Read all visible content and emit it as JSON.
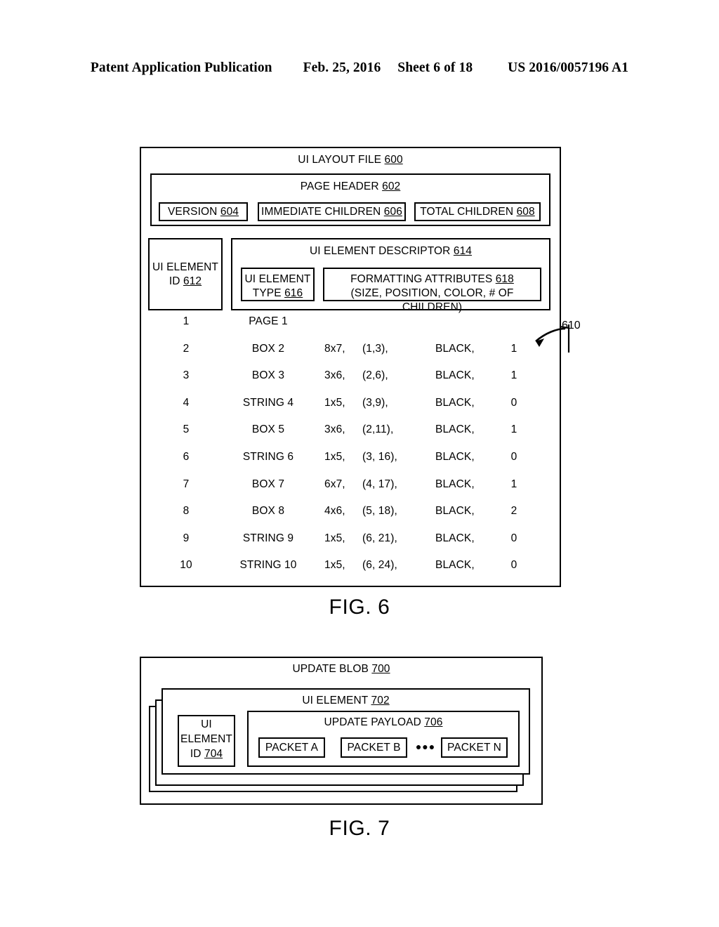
{
  "header": {
    "publication": "Patent Application Publication",
    "date": "Feb. 25, 2016",
    "sheet": "Sheet 6 of 18",
    "patent_number": "US 2016/0057196 A1"
  },
  "fig6": {
    "caption": "FIG. 6",
    "title": "UI LAYOUT FILE",
    "title_ref": "600",
    "page_header": {
      "title": "PAGE HEADER",
      "ref": "602",
      "fields": [
        {
          "label": "VERSION",
          "ref": "604"
        },
        {
          "label": "IMMEDIATE CHILDREN",
          "ref": "606"
        },
        {
          "label": "TOTAL CHILDREN",
          "ref": "608"
        }
      ]
    },
    "element_id_box": {
      "line1": "UI ELEMENT",
      "line2": "ID",
      "ref": "612"
    },
    "descriptor": {
      "title": "UI ELEMENT DESCRIPTOR",
      "ref": "614",
      "type_box": {
        "line1": "UI ELEMENT",
        "line2": "TYPE",
        "ref": "616"
      },
      "attributes_box": {
        "line1": "FORMATTING ATTRIBUTES",
        "ref": "618",
        "line2": "(SIZE, POSITION, COLOR, # OF CHILDREN)"
      }
    },
    "table_ref": "610",
    "rows": [
      {
        "id": "1",
        "type": "PAGE 1",
        "size": "",
        "position": "",
        "color": "",
        "children": ""
      },
      {
        "id": "2",
        "type": "BOX 2",
        "size": "8x7,",
        "position": "(1,3),",
        "color": "BLACK,",
        "children": "1"
      },
      {
        "id": "3",
        "type": "BOX 3",
        "size": "3x6,",
        "position": "(2,6),",
        "color": "BLACK,",
        "children": "1"
      },
      {
        "id": "4",
        "type": "STRING 4",
        "size": "1x5,",
        "position": "(3,9),",
        "color": "BLACK,",
        "children": "0"
      },
      {
        "id": "5",
        "type": "BOX 5",
        "size": "3x6,",
        "position": "(2,11),",
        "color": "BLACK,",
        "children": "1"
      },
      {
        "id": "6",
        "type": "STRING 6",
        "size": "1x5,",
        "position": "(3, 16),",
        "color": "BLACK,",
        "children": "0"
      },
      {
        "id": "7",
        "type": "BOX 7",
        "size": "6x7,",
        "position": "(4, 17),",
        "color": "BLACK,",
        "children": "1"
      },
      {
        "id": "8",
        "type": "BOX 8",
        "size": "4x6,",
        "position": "(5, 18),",
        "color": "BLACK,",
        "children": "2"
      },
      {
        "id": "9",
        "type": "STRING 9",
        "size": "1x5,",
        "position": "(6, 21),",
        "color": "BLACK,",
        "children": "0"
      },
      {
        "id": "10",
        "type": "STRING 10",
        "size": "1x5,",
        "position": "(6, 24),",
        "color": "BLACK,",
        "children": "0"
      }
    ]
  },
  "fig7": {
    "caption": "FIG. 7",
    "title": "UPDATE BLOB",
    "title_ref": "700",
    "ui_element": {
      "title": "UI ELEMENT",
      "ref": "702"
    },
    "element_id_box": {
      "line1": "UI",
      "line2": "ELEMENT",
      "line3": "ID",
      "ref": "704"
    },
    "payload": {
      "title": "UPDATE PAYLOAD",
      "ref": "706",
      "packets": [
        {
          "label": "PACKET A"
        },
        {
          "label": "PACKET B"
        },
        {
          "label": "PACKET N"
        }
      ],
      "ellipsis": "●●●"
    }
  }
}
